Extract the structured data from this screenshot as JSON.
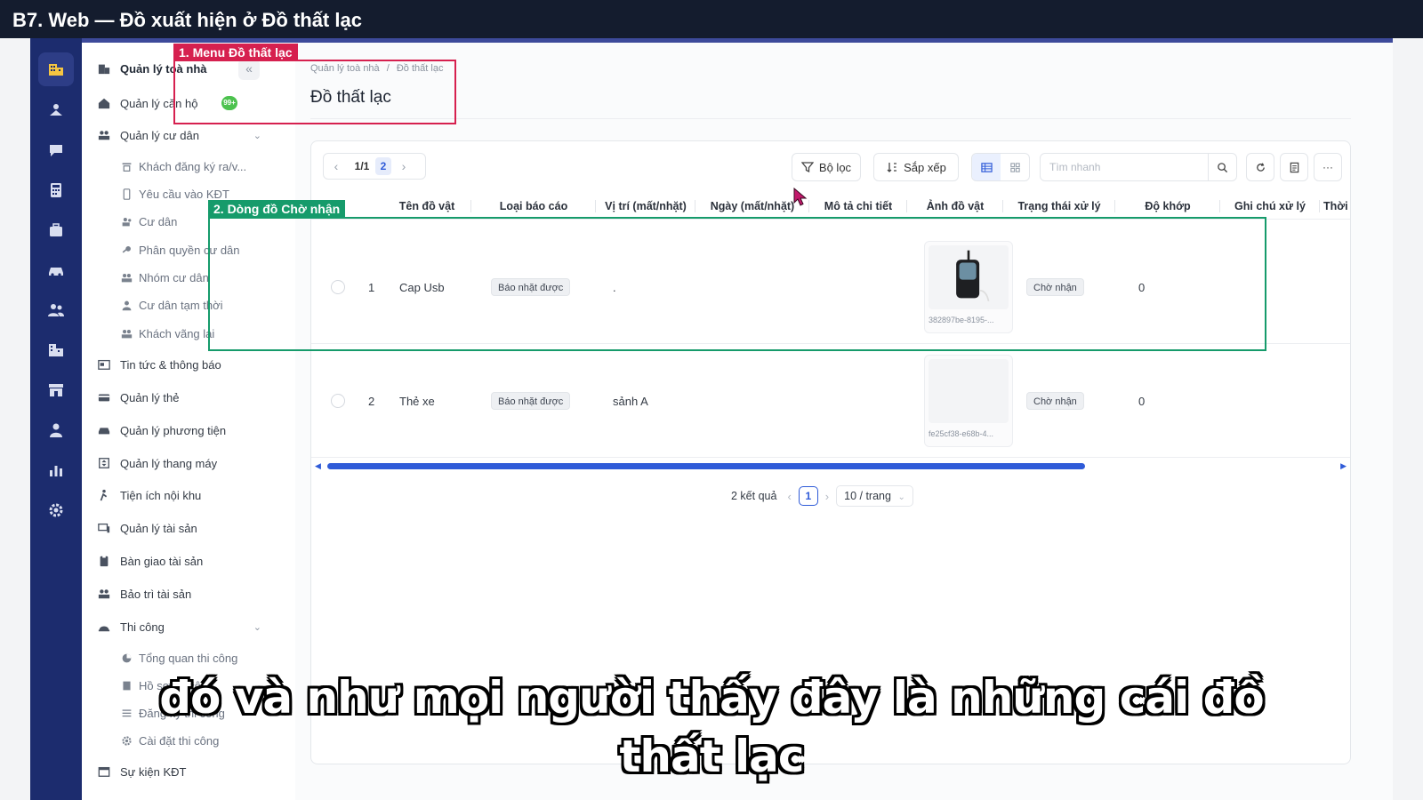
{
  "video_title": "B7. Web — Đồ xuất hiện ở Đồ thất lạc",
  "sidebar": {
    "collapse_label": "«",
    "items": [
      {
        "label": "Quản lý toà nhà",
        "icon": "building-icon",
        "bold": true
      },
      {
        "label": "Quản lý căn hộ",
        "icon": "home-icon",
        "badge": "99+"
      },
      {
        "label": "Quản lý cư dân",
        "icon": "residents-icon",
        "chevron": "⌄"
      },
      {
        "label": "Khách đăng ký ra/v...",
        "icon": "register-icon"
      },
      {
        "label": "Yêu cầu vào KĐT",
        "icon": "phone-icon"
      },
      {
        "label": "Cư dân",
        "icon": "user-group-icon"
      },
      {
        "label": "Phân quyền cư dân",
        "icon": "key-icon"
      },
      {
        "label": "Nhóm cư dân",
        "icon": "group-icon"
      },
      {
        "label": "Cư dân tạm thời",
        "icon": "user-icon"
      },
      {
        "label": "Khách vãng lai",
        "icon": "guests-icon"
      },
      {
        "label": "Tin tức & thông báo",
        "icon": "news-icon"
      },
      {
        "label": "Quản lý thẻ",
        "icon": "card-icon"
      },
      {
        "label": "Quản lý phương tiện",
        "icon": "car-icon"
      },
      {
        "label": "Quản lý thang máy",
        "icon": "elevator-icon"
      },
      {
        "label": "Tiện ích nội khu",
        "icon": "amenity-icon"
      },
      {
        "label": "Quản lý tài sản",
        "icon": "asset-icon"
      },
      {
        "label": "Bàn giao tài sản",
        "icon": "handover-icon"
      },
      {
        "label": "Bảo trì tài sản",
        "icon": "maintenance-icon"
      },
      {
        "label": "Thi công",
        "icon": "construction-icon",
        "chevron": "⌄"
      },
      {
        "label": "Tổng quan thi công",
        "icon": "pie-icon"
      },
      {
        "label": "Hồ sơ thi công",
        "icon": "file-icon"
      },
      {
        "label": "Đăng ký thi công",
        "icon": "list-icon"
      },
      {
        "label": "Cài đặt thi công",
        "icon": "gear-icon"
      },
      {
        "label": "Sự kiện KĐT",
        "icon": "calendar-icon"
      }
    ]
  },
  "breadcrumb": {
    "root": "Quản lý toà nhà",
    "sep": "/",
    "current": "Đồ thất lạc"
  },
  "page_title": "Đồ thất lạc",
  "toolbar": {
    "pager_current": "1/1",
    "pager_next": "2",
    "filter_label": "Bộ lọc",
    "sort_label": "Sắp xếp",
    "search_placeholder": "Tìm nhanh",
    "more_label": "···"
  },
  "table": {
    "headers": [
      "Tên đồ vật",
      "Loại báo cáo",
      "Vị trí (mất/nhặt)",
      "Ngày (mất/nhặt)",
      "Mô tả chi tiết",
      "Ảnh đồ vật",
      "Trạng thái xử lý",
      "Độ khớp",
      "Ghi chú xử lý",
      "Thời"
    ],
    "rows": [
      {
        "index": "1",
        "name": "Cap Usb",
        "report_type": "Báo nhặt được",
        "location": ".",
        "image_caption": "382897be-8195-...",
        "status": "Chờ nhận",
        "match": "0"
      },
      {
        "index": "2",
        "name": "Thẻ xe",
        "report_type": "Báo nhặt được",
        "location": "sảnh A",
        "image_caption": "fe25cf38-e68b-4...",
        "status": "Chờ nhận",
        "match": "0"
      }
    ]
  },
  "pagination": {
    "total": "2 kết quả",
    "prev": "‹",
    "current": "1",
    "next": "›",
    "page_size": "10 / trang",
    "page_size_chevron": "⌄"
  },
  "annotations": {
    "menu_label": "1. Menu Đồ thất lạc",
    "row_label": "2. Dòng đồ Chờ nhận",
    "menu_color": "#d6204f",
    "row_color": "#169b6b"
  },
  "subtitle": {
    "line1": "đó và như mọi người thấy đây là những cái đồ",
    "line2": "thất lạc"
  },
  "colors": {
    "primary": "#2f5bd8",
    "rail": "#1c2c6e",
    "title_bar": "#141c2e"
  }
}
